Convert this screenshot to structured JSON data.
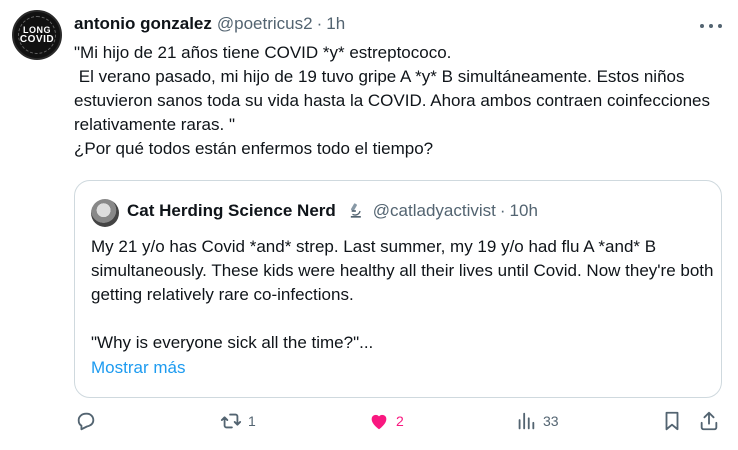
{
  "tweet": {
    "author_name": "antonio gonzalez",
    "author_handle": "@poetricus2",
    "separator": "·",
    "time": "1h",
    "text": "\"Mi hijo de 21 años tiene COVID *y* estreptococo.\n El verano pasado, mi hijo de 19 tuvo gripe A *y* B simultáneamente. Estos niños estuvieron sanos toda su vida hasta la COVID. Ahora ambos contraen coinfecciones relativamente raras. \"\n¿Por qué todos están enfermos todo el tiempo?",
    "avatar_text": [
      "LONG",
      "COVID"
    ]
  },
  "quote": {
    "author_name": "Cat Herding Science Nerd",
    "badge_icon": "microscope-icon",
    "author_handle": "@catladyactivist",
    "separator": "·",
    "time": "10h",
    "text": "My 21 y/o has Covid *and* strep. Last summer, my 19 y/o had flu A *and* B simultaneously. These kids were healthy all their lives until Covid. Now they're both getting relatively rare co-infections.\n\n\"Why is everyone sick all the time?\"...",
    "show_more": "Mostrar más"
  },
  "actions": {
    "replies": "",
    "retweets": "1",
    "likes": "2",
    "views": "33"
  },
  "colors": {
    "text": "#0f1419",
    "secondary": "#536471",
    "link": "#1d9bf0",
    "like": "#f91880",
    "border": "#cfd9de"
  }
}
